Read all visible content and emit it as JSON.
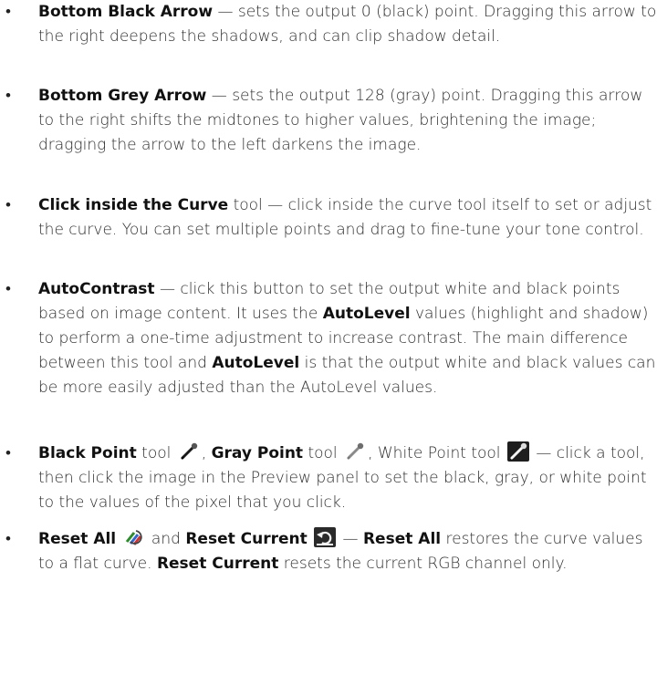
{
  "items": [
    {
      "term": "Bottom Black Arrow",
      "text": " — sets the output 0 (black) point. Dragging this arrow to the right deepens the shadows, and can clip shadow detail."
    },
    {
      "term": "Bottom Grey Arrow",
      "text": " — sets the output 128 (gray) point. Dragging this arrow to the right shifts the midtones to higher values, brightening the image; dragging the arrow to the left darkens the image."
    },
    {
      "term": "Click inside the Curve",
      "text": " tool — click inside the curve tool itself to set or adjust the curve. You can set multiple points and drag to fine-tune your tone control."
    },
    {
      "term": "AutoContrast",
      "t1": " — click this button to set the output white and black points based on image content. It uses the ",
      "b1": "AutoLevel",
      "t2": " values (highlight and shadow) to perform a one-time adjustment to increase contrast. The main difference between this tool and ",
      "b2": "AutoLevel",
      "t3": " is that the output white and black values can be more easily adjusted than the AutoLevel values."
    },
    {
      "b_black": "Black Point",
      "t_tool1": " tool ",
      "sep1": ", ",
      "b_gray": "Gray Point",
      "t_tool2": " tool ",
      "t_white": ", White Point tool ",
      "t_rest": " — click a tool, then click the image in the Preview panel to set the black, gray, or white point to the values of the pixel that you click."
    },
    {
      "b_resetall": "Reset All",
      "t_and": " and ",
      "b_resetcur": "Reset Current",
      "t_dash": " — ",
      "b_resetall2": "Reset All",
      "t_restores": " restores the curve values to a flat curve. ",
      "b_resetcur2": "Reset Current",
      "t_end": " resets the current RGB channel only."
    }
  ],
  "icons": {
    "black_point": "eyedropper-black-icon",
    "gray_point": "eyedropper-gray-icon",
    "white_point": "eyedropper-white-icon",
    "reset_all": "reset-all-icon",
    "reset_current": "reset-current-icon"
  }
}
